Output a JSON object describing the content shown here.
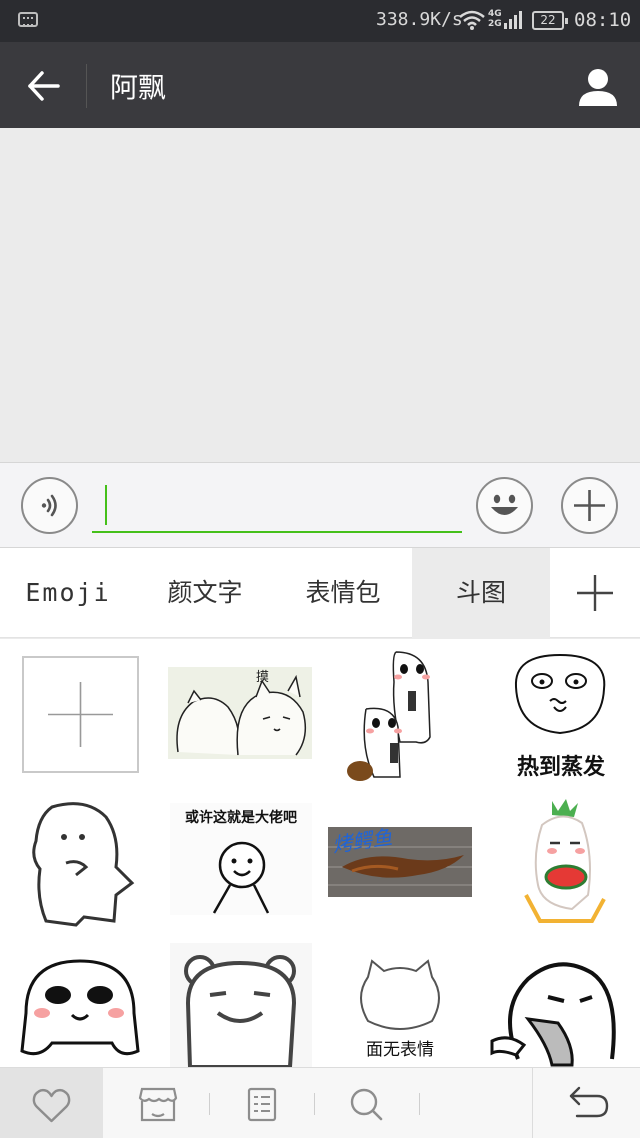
{
  "status_bar": {
    "net_speed": "338.9K/s",
    "network_type_top": "4G",
    "network_type_bottom": "2G",
    "battery": "22",
    "time": "08:10"
  },
  "header": {
    "contact_name": "阿飘",
    "back_icon": "arrow-left-icon",
    "profile_icon": "person-icon"
  },
  "input_bar": {
    "voice_icon": "voice-icon",
    "emoji_icon": "smiley-icon",
    "more_icon": "plus-icon",
    "message_value": ""
  },
  "sticker_tabs": [
    {
      "label": "Emoji"
    },
    {
      "label": "颜文字"
    },
    {
      "label": "表情包"
    },
    {
      "label": "斗图",
      "selected": true
    },
    {
      "icon": "plus-icon"
    }
  ],
  "stickers": [
    {
      "name": "add-sticker",
      "icon": "plus-icon"
    },
    {
      "name": "cats-hugging",
      "caption": "摸"
    },
    {
      "name": "two-blobs-stacked",
      "caption": ""
    },
    {
      "name": "sweating-face",
      "caption": "热到蒸发"
    },
    {
      "name": "white-blob-dancing",
      "caption": ""
    },
    {
      "name": "stick-figure-boss",
      "caption": "或许这就是大佬吧"
    },
    {
      "name": "grilled-fish",
      "caption": "烤鳄鱼"
    },
    {
      "name": "radish-eating-watermelon",
      "caption": ""
    },
    {
      "name": "blob-blushing",
      "caption": ""
    },
    {
      "name": "bear-smiling",
      "caption": ""
    },
    {
      "name": "cat-blank",
      "caption": "面无表情"
    },
    {
      "name": "blob-tongue",
      "caption": ""
    }
  ],
  "bottom_bar": [
    {
      "icon": "heart-icon",
      "selected": true
    },
    {
      "icon": "shop-icon"
    },
    {
      "icon": "list-icon"
    },
    {
      "icon": "search-icon"
    },
    {
      "icon": "undo-icon"
    }
  ],
  "colors": {
    "accent_green": "#45c01a",
    "header_bg": "#3a3a3e",
    "status_bg": "#2b2c30"
  }
}
